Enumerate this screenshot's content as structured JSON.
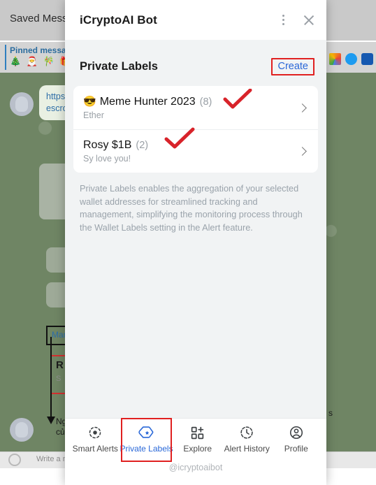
{
  "background": {
    "window_title": "Saved Messages",
    "pinned_label": "Pinned message",
    "pinned_emoji": "🎄 🎅 🎋 🎁",
    "bubble_text": "https://t.me/\nroute/\nescrow",
    "annotation_blue_text": "Market",
    "annotation_red_title": "R",
    "annotation_red_sub": "S",
    "annotation_bottom_text": "Người\ncủa",
    "annotation_right_text": "s",
    "composer_placeholder": "Write a message...",
    "extension_icons": [
      "google-play-icon",
      "verified-badge-icon",
      "shield-icon"
    ]
  },
  "panel": {
    "header": {
      "title": "iCryptoAI Bot",
      "menu_icon": "more-vertical-icon",
      "close_icon": "close-icon"
    },
    "section": {
      "title": "Private Labels",
      "create_label": "Create"
    },
    "labels": [
      {
        "emoji": "😎",
        "name": "Meme Hunter 2023",
        "count": "(8)",
        "subtitle": "Ether",
        "chevron": "chevron-right-icon",
        "annotated": true
      },
      {
        "emoji": "",
        "name": "Rosy $1B",
        "count": "(2)",
        "subtitle": "Sy love you!",
        "chevron": "chevron-right-icon",
        "annotated": true
      }
    ],
    "description": "Private Labels enables the aggregation of your selected wallet addresses for streamlined tracking and management, simplifying the monitoring process through the Wallet Labels setting in the Alert feature.",
    "nav": [
      {
        "label": "Smart Alerts",
        "icon": "smart-alerts-icon",
        "active": false,
        "highlighted": false
      },
      {
        "label": "Private Labels",
        "icon": "tag-icon",
        "active": true,
        "highlighted": true
      },
      {
        "label": "Explore",
        "icon": "grid-plus-icon",
        "active": false,
        "highlighted": false
      },
      {
        "label": "Alert History",
        "icon": "clock-history-icon",
        "active": false,
        "highlighted": false
      },
      {
        "label": "Profile",
        "icon": "profile-icon",
        "active": false,
        "highlighted": false
      }
    ],
    "footer_handle": "@icryptoaibot"
  },
  "colors": {
    "accent_blue": "#2a68d8",
    "annotation_red": "#e02020",
    "panel_bg": "#f1f3f4",
    "card_bg": "#ffffff",
    "muted_text": "#9aa0a6"
  }
}
